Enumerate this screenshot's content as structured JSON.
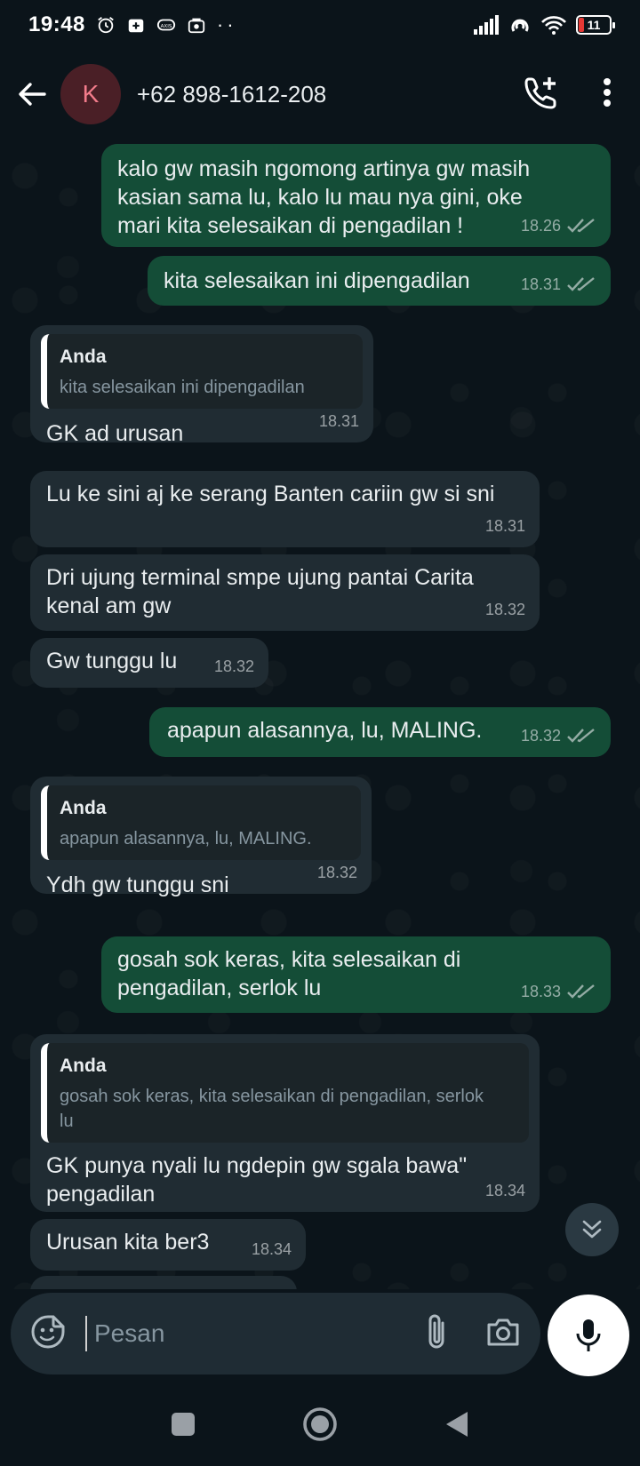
{
  "status_bar": {
    "time": "19:48",
    "battery": "11"
  },
  "header": {
    "avatar_letter": "K",
    "contact": "+62 898-1612-208"
  },
  "messages": [
    {
      "dir": "out",
      "text": "kalo gw masih ngomong artinya gw masih kasian sama lu, kalo lu mau nya gini, oke mari kita selesaikan di pengadilan !",
      "time": "18.26"
    },
    {
      "dir": "out",
      "text": "kita selesaikan ini dipengadilan",
      "time": "18.31"
    },
    {
      "dir": "in",
      "quote_author": "Anda",
      "quote_text": "kita selesaikan ini dipengadilan",
      "text": "GK ad urusan",
      "time": "18.31"
    },
    {
      "dir": "in",
      "text": "Lu ke sini aj ke serang Banten cariin gw si sni",
      "time": "18.31"
    },
    {
      "dir": "in",
      "text": "Dri ujung terminal smpe ujung pantai Carita kenal am gw",
      "time": "18.32"
    },
    {
      "dir": "in",
      "text": "Gw tunggu lu",
      "time": "18.32"
    },
    {
      "dir": "out",
      "text": "apapun alasannya, lu, MALING.",
      "time": "18.32"
    },
    {
      "dir": "in",
      "quote_author": "Anda",
      "quote_text": "apapun alasannya, lu, MALING.",
      "text": "Ydh gw tunggu sni",
      "time": "18.32"
    },
    {
      "dir": "out",
      "text": "gosah sok keras, kita selesaikan di pengadilan, serlok lu",
      "time": "18.33"
    },
    {
      "dir": "in",
      "quote_author": "Anda",
      "quote_text": "gosah sok keras, kita selesaikan di pengadilan, serlok lu",
      "text": "GK punya nyali lu ngdepin gw sgala bawa\" pengadilan",
      "time": "18.34"
    },
    {
      "dir": "in",
      "text": "Urusan kita ber3",
      "time": "18.34"
    }
  ],
  "composer": {
    "placeholder": "Pesan"
  }
}
